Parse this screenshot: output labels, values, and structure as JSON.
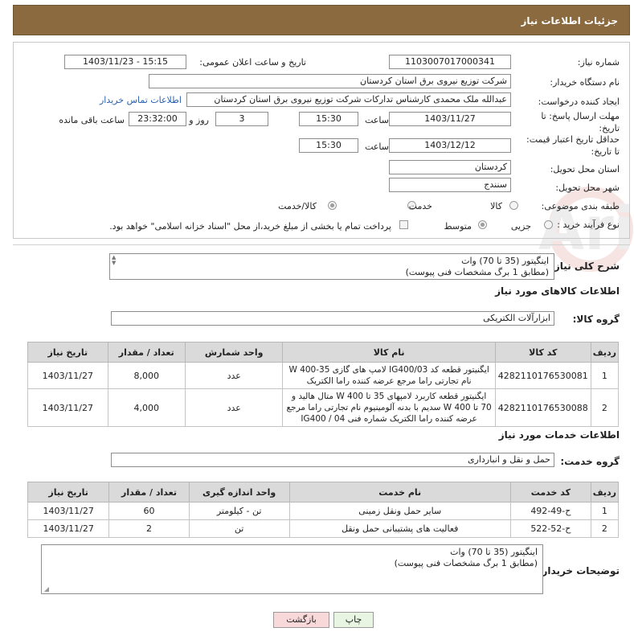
{
  "header": {
    "title": "جزئیات اطلاعات نیاز"
  },
  "form": {
    "need_number_label": "شماره نیاز:",
    "need_number": "1103007017000341",
    "announce_label": "تاریخ و ساعت اعلان عمومی:",
    "announce_value": "1403/11/23 - 15:15",
    "buyer_org_label": "نام دستگاه خریدار:",
    "buyer_org": "شرکت توزیع نیروی برق استان کردستان",
    "creator_label": "ایجاد کننده درخواست:",
    "creator": "عبدالله ملک محمدی کارشناس تدارکات شرکت توزیع نیروی برق استان کردستان",
    "contact_link": "اطلاعات تماس خریدار",
    "deadline_label": "مهلت ارسال پاسخ: تا تاریخ:",
    "deadline_date": "1403/11/27",
    "time_label": "ساعت",
    "deadline_time": "15:30",
    "days_value": "3",
    "days_label": "روز و",
    "remaining_time": "23:32:00",
    "remaining_label": "ساعت باقی مانده",
    "validity_label": "حداقل تاریخ اعتبار قیمت: تا تاریخ:",
    "validity_date": "1403/12/12",
    "validity_time": "15:30",
    "province_label": "استان محل تحویل:",
    "province": "کردستان",
    "city_label": "شهر محل تحویل:",
    "city": "سنندج",
    "category_label": "طبقه بندی موضوعی:",
    "category_options": [
      "کالا",
      "خدمت",
      "کالا/خدمت"
    ],
    "process_label": "نوع فرآیند خرید :",
    "process_options": [
      "جزیی",
      "متوسط"
    ],
    "payment_note": "پرداخت تمام یا بخشی از مبلغ خرید،از محل \"اسناد خزانه اسلامی\" خواهد بود."
  },
  "summary": {
    "label": "شرح کلی نیاز:",
    "line1": "اینگیتور (35 تا 70) وات",
    "line2": "(مطابق 1 برگ مشخصات فنی پیوست)"
  },
  "goods": {
    "section_title": "اطلاعات کالاهای مورد نیاز",
    "group_label": "گروه کالا:",
    "group_value": "ابزارآلات الکتریکی",
    "headers": [
      "ردیف",
      "کد کالا",
      "نام کالا",
      "واحد شمارش",
      "تعداد / مقدار",
      "تاریخ نیاز"
    ],
    "rows": [
      {
        "row": "1",
        "code": "4282110176530081",
        "name": "ایگنیتور قطعه کد IG400/03 لامپ های گازی 35-400 W نام تجارتی راما مرجع عرضه کننده راما الکتریک",
        "unit": "عدد",
        "qty": "8,000",
        "date": "1403/11/27"
      },
      {
        "row": "2",
        "code": "4282110176530088",
        "name": "ایگنیتور قطعه کاربرد لامپهای 35 تا 400 W متال هالید و 70 تا 400 W سدیم با بدنه آلومینیوم نام تجارتی راما مرجع عرضه کننده راما الکتریک شماره فنی IG400 / 04",
        "unit": "عدد",
        "qty": "4,000",
        "date": "1403/11/27"
      }
    ]
  },
  "services": {
    "section_title": "اطلاعات خدمات مورد نیاز",
    "group_label": "گروه خدمت:",
    "group_value": "حمل و نقل و انبارداری",
    "headers": [
      "ردیف",
      "کد خدمت",
      "نام خدمت",
      "واحد اندازه گیری",
      "تعداد / مقدار",
      "تاریخ نیاز"
    ],
    "rows": [
      {
        "row": "1",
        "code": "ح-49-492",
        "name": "سایر حمل ونقل زمینی",
        "unit": "تن - کیلومتر",
        "qty": "60",
        "date": "1403/11/27"
      },
      {
        "row": "2",
        "code": "ح-52-522",
        "name": "فعالیت های پشتیبانی حمل ونقل",
        "unit": "تن",
        "qty": "2",
        "date": "1403/11/27"
      }
    ]
  },
  "buyer_notes": {
    "label": "توضیحات خریدار:",
    "line1": "اینگیتور (35 تا 70) وات",
    "line2": "(مطابق 1 برگ مشخصات فنی پیوست)"
  },
  "buttons": {
    "print": "چاپ",
    "back": "بازگشت"
  },
  "watermark": {
    "text": "AriaTender.neT"
  }
}
